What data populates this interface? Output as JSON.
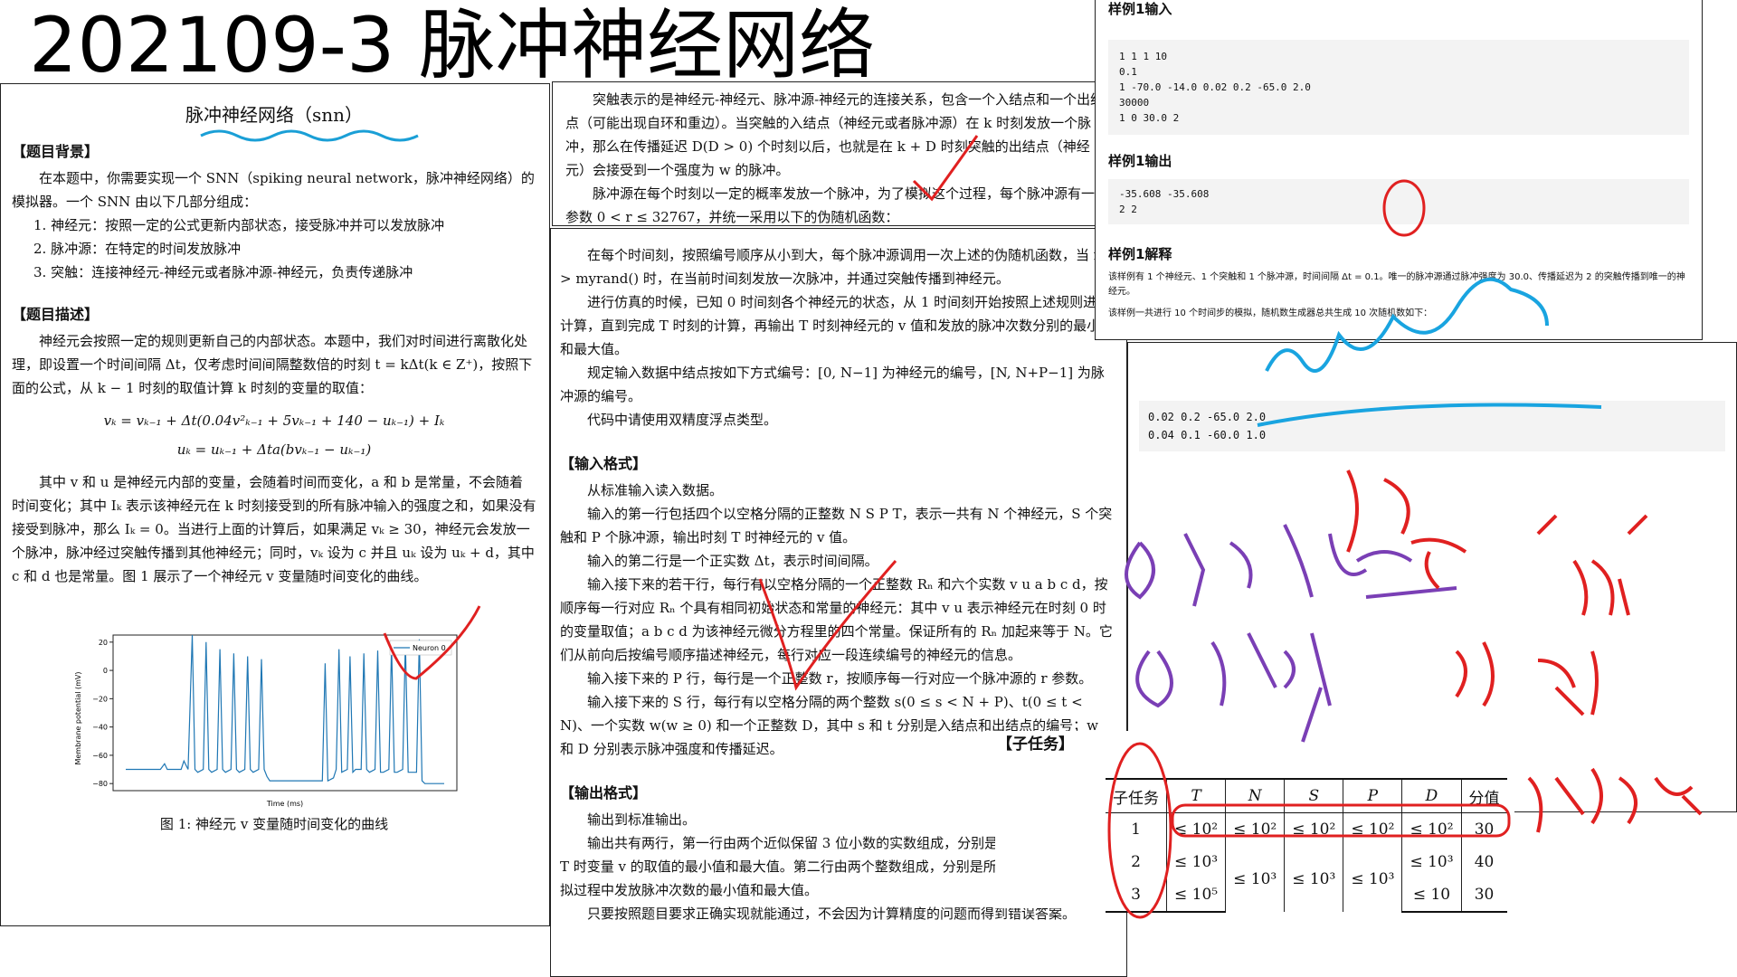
{
  "slide": {
    "title": "202109-3 脉冲神经网络"
  },
  "left_page": {
    "doc_title": "脉冲神经网络（snn）",
    "bg_heading": "【题目背景】",
    "bg_text": "在本题中，你需要实现一个 SNN（spiking neural network，脉冲神经网络）的模拟器。一个 SNN 由以下几部分组成：",
    "list": [
      "1. 神经元：按照一定的公式更新内部状态，接受脉冲并可以发放脉冲",
      "2. 脉冲源：在特定的时间发放脉冲",
      "3. 突触：连接神经元-神经元或者脉冲源-神经元，负责传递脉冲"
    ],
    "desc_heading": "【题目描述】",
    "desc_text": "神经元会按照一定的规则更新自己的内部状态。本题中，我们对时间进行离散化处理，即设置一个时间间隔 Δt，仅考虑时间间隔整数倍的时刻 t = kΔt(k ∈ Z⁺)，按照下面的公式，从 k − 1 时刻的取值计算 k 时刻的变量的取值：",
    "eq1": "vₖ = vₖ₋₁ + Δt(0.04v²ₖ₋₁ + 5vₖ₋₁ + 140 − uₖ₋₁) + Iₖ",
    "eq2": "uₖ = uₖ₋₁ + Δta(bvₖ₋₁ − uₖ₋₁)",
    "after_text": "其中 v 和 u 是神经元内部的变量，会随着时间而变化，a 和 b 是常量，不会随着时间变化；其中 Iₖ 表示该神经元在 k 时刻接受到的所有脉冲输入的强度之和，如果没有接受到脉冲，那么 Iₖ = 0。当进行上面的计算后，如果满足 vₖ ≥ 30，神经元会发放一个脉冲，脉冲经过突触传播到其他神经元；同时，vₖ 设为 c 并且 uₖ 设为 uₖ + d，其中 c 和 d 也是常量。图 1 展示了一个神经元 v 变量随时间变化的曲线。",
    "caption": "图 1: 神经元 v 变量随时间变化的曲线"
  },
  "chart_data": {
    "type": "line",
    "title": "",
    "xlabel": "Time (ms)",
    "ylabel": "Membrane potential (mV)",
    "yticks": [
      "20",
      "0",
      "−20",
      "−40",
      "−60",
      "−80"
    ],
    "ylim": [
      -85,
      25
    ],
    "legend": "top-right",
    "series": [
      {
        "name": "Neuron 0",
        "color": "#1f77b4",
        "x": [
          0,
          12,
          25,
          28,
          30,
          32,
          34,
          38,
          40,
          42,
          45,
          48,
          50,
          52,
          56,
          58,
          60,
          62,
          66,
          68,
          70,
          72,
          76,
          78,
          80,
          82,
          86,
          88,
          90,
          92,
          96,
          98,
          100,
          102,
          104,
          106,
          140,
          142,
          144,
          146,
          150,
          152,
          154,
          156,
          160,
          162,
          164,
          166,
          170,
          172,
          174,
          176,
          180,
          182,
          184,
          186,
          190,
          192,
          194,
          196,
          200,
          202,
          204,
          206,
          210,
          212,
          214,
          216,
          220,
          224,
          230
        ],
        "y": [
          -70,
          -70,
          -70,
          -66,
          -70,
          -70,
          -70,
          -70,
          -70,
          -64,
          -70,
          25,
          -70,
          -72,
          -70,
          20,
          -70,
          -72,
          -70,
          15,
          -70,
          -72,
          -70,
          12,
          -70,
          -72,
          -70,
          10,
          -70,
          -72,
          -70,
          8,
          -70,
          -75,
          -78,
          -78,
          -78,
          -78,
          5,
          -78,
          -76,
          -70,
          15,
          -72,
          -70,
          10,
          -72,
          -70,
          -70,
          12,
          -70,
          -72,
          -70,
          14,
          -72,
          -72,
          -70,
          18,
          -72,
          -72,
          -70,
          20,
          -72,
          -72,
          -72,
          22,
          -78,
          -80,
          -80,
          -80,
          -80
        ]
      }
    ]
  },
  "mid_top": {
    "p1": "突触表示的是神经元-神经元、脉冲源-神经元的连接关系，包含一个入结点和一个出结点（可能出现自环和重边）。当突触的入结点（神经元或者脉冲源）在 k 时刻发放一个脉冲，那么在传播延迟 D(D > 0) 个时刻以后，也就是在 k + D 时刻突触的出结点（神经元）会接受到一个强度为 w 的脉冲。",
    "p2": "脉冲源在每个时刻以一定的概率发放一个脉冲，为了模拟这个过程，每个脉冲源有一个参数 0 < r ≤ 32767，并统一采用以下的伪随机函数："
  },
  "mid_main": {
    "p1": "在每个时间刻，按照编号顺序从小到大，每个脉冲源调用一次上述的伪随机函数，当 r > myrand() 时，在当前时间刻发放一次脉冲，并通过突触传播到神经元。",
    "p2": "进行仿真的时候，已知 0 时间刻各个神经元的状态，从 1 时间刻开始按照上述规则进行计算，直到完成 T 时刻的计算，再输出 T 时刻神经元的 v 值和发放的脉冲次数分别的最小值和最大值。",
    "p3": "规定输入数据中结点按如下方式编号：[0, N−1] 为神经元的编号，[N, N+P−1] 为脉冲源的编号。",
    "p4": "代码中请使用双精度浮点类型。",
    "in_heading": "【输入格式】",
    "in_lines": [
      "从标准输入读入数据。",
      "输入的第一行包括四个以空格分隔的正整数 N S P T，表示一共有 N 个神经元，S 个突触和 P 个脉冲源，输出时刻 T 时神经元的 v 值。",
      "输入的第二行是一个正实数 Δt，表示时间间隔。",
      "输入接下来的若干行，每行有以空格分隔的一个正整数 Rₙ 和六个实数 v u a b c d，按顺序每一行对应 Rₙ 个具有相同初始状态和常量的神经元：其中 v u 表示神经元在时刻 0 时的变量取值；a b c d 为该神经元微分方程里的四个常量。保证所有的 Rₙ 加起来等于 N。它们从前向后按编号顺序描述神经元，每行对应一段连续编号的神经元的信息。",
      "输入接下来的 P 行，每行是一个正整数 r，按顺序每一行对应一个脉冲源的 r 参数。",
      "输入接下来的 S 行，每行有以空格分隔的两个整数 s(0 ≤ s < N + P)、t(0 ≤ t < N)、一个实数 w(w ≥ 0) 和一个正整数 D，其中 s 和 t 分别是入结点和出结点的编号；w 和 D 分别表示脉冲强度和传播延迟。"
    ],
    "out_heading": "【输出格式】",
    "out_lines": [
      "输出到标准输出。",
      "输出共有两行，第一行由两个近似保留 3 位小数的实数组成，分别是所有神经元在时刻 T 时变量 v 的取值的最小值和最大值。第二行由两个整数组成，分别是所有神经元在整个模拟过程中发放脉冲次数的最小值和最大值。",
      "只要按照题目要求正确实现就能通过，不会因为计算精度的问题而得到错误答案。"
    ]
  },
  "sample": {
    "in_heading": "样例1输入",
    "in_code": "1 1 1 10\n0.1\n1 -70.0 -14.0 0.02 0.2 -65.0 2.0\n30000\n1 0 30.0 2",
    "out_heading": "样例1输出",
    "out_code": "-35.608 -35.608\n2 2",
    "exp_heading": "样例1解释",
    "exp_text1": "该样例有 1 个神经元、1 个突触和 1 个脉冲源，时间间隔 Δt = 0.1。唯一的脉冲源通过脉冲强度为 30.0、传播延迟为 2 的突触传播到唯一的神经元。",
    "exp_text2": "该样例一共进行 10 个时间步的模拟，随机数生成器总共生成 10 次随机数如下：",
    "sample2_code": "0.02 0.2 -65.0 2.0\n0.04 0.1 -60.0 1.0"
  },
  "subtask": {
    "heading": "【子任务】",
    "headers": [
      "子任务",
      "T",
      "N",
      "S",
      "P",
      "D",
      "分值"
    ],
    "rows": [
      [
        "1",
        "≤ 10²",
        "≤ 10²",
        "≤ 10²",
        "≤ 10²",
        "≤ 10²",
        "30"
      ],
      [
        "2",
        "≤ 10³",
        "≤ 10³",
        "≤ 10³",
        "≤ 10³",
        "≤ 10³",
        "40"
      ],
      [
        "3",
        "≤ 10⁵",
        "",
        "",
        "",
        "≤ 10",
        "30"
      ]
    ]
  }
}
